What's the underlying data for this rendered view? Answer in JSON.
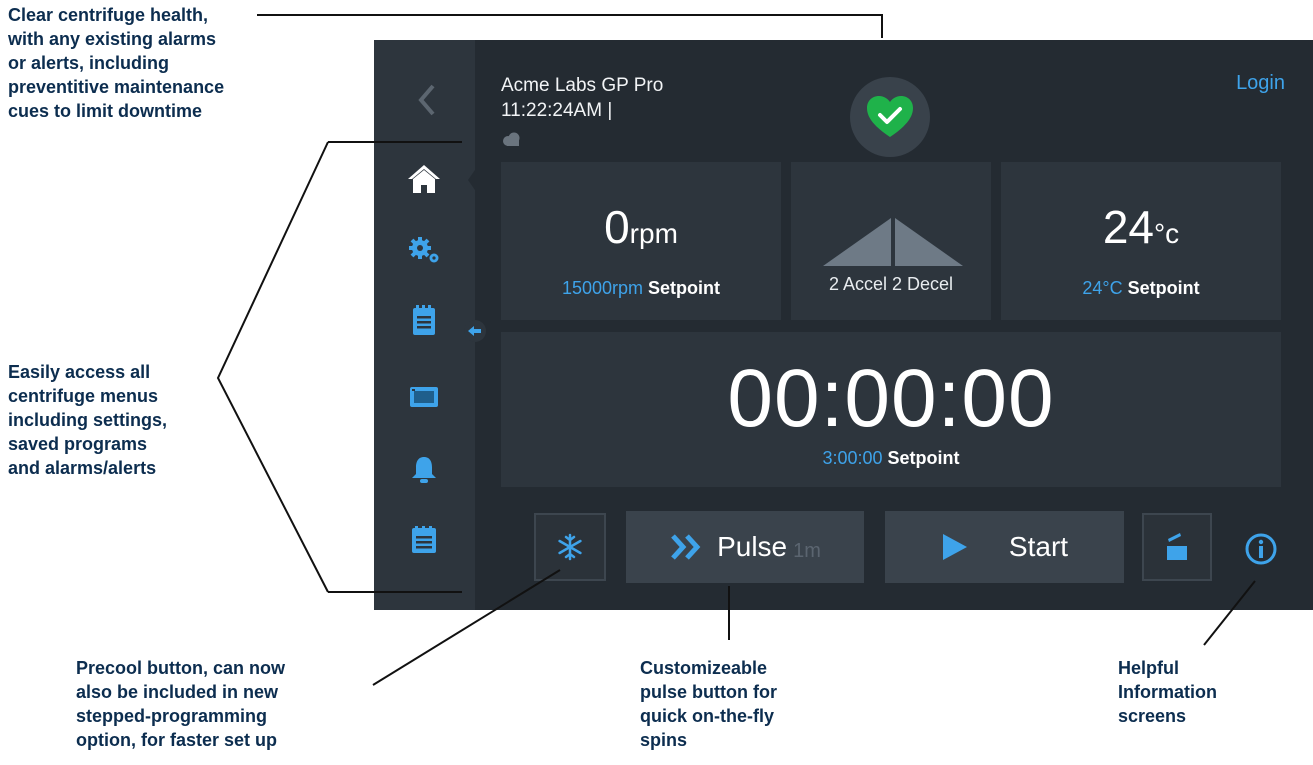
{
  "annotations": {
    "health": "Clear centrifuge health,\nwith any existing alarms\nor alerts, including\npreventitive maintenance\ncues to limit downtime",
    "menus": "Easily access all\ncentrifuge menus\nincluding settings,\nsaved programs\nand alarms/alerts",
    "precool": "Precool button,  can now\nalso be included in new\nstepped-programming\noption, for faster set up",
    "pulse": "Customizeable\npulse button for\nquick on-the-fly\nspins",
    "info": "Helpful\nInformation\nscreens"
  },
  "header": {
    "device_name": "Acme Labs GP Pro",
    "clock": "11:22:24AM |",
    "login_label": "Login",
    "health_status": "ok"
  },
  "sidebar": {
    "items": [
      "home-icon",
      "settings-gears-icon",
      "programs-clipboard-icon",
      "display-icon",
      "bell-icon",
      "logs-icon"
    ],
    "active": "home-icon"
  },
  "speed": {
    "value": "0",
    "unit": "rpm",
    "setpoint_value": "15000rpm",
    "setpoint_label": "Setpoint"
  },
  "ramp": {
    "accel": "2 Accel",
    "decel": "2 Decel"
  },
  "temperature": {
    "value": "24",
    "unit": "°c",
    "setpoint_value": "24°C",
    "setpoint_label": "Setpoint"
  },
  "timer": {
    "value": "00:00:00",
    "setpoint_value": "3:00:00",
    "setpoint_label": "Setpoint"
  },
  "actions": {
    "pulse_label": "Pulse",
    "pulse_sub": "1m",
    "start_label": "Start"
  },
  "colors": {
    "accent": "#3ea3ea",
    "health_ok": "#1fb24a",
    "panel": "#2d353d",
    "background": "#232a31"
  }
}
